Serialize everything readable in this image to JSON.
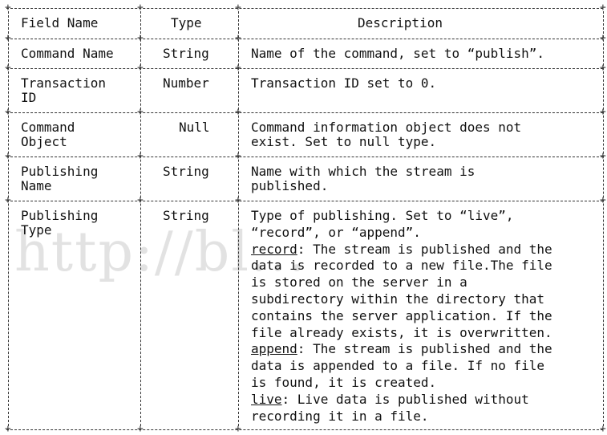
{
  "header": {
    "field_name": "Field Name",
    "type": "Type",
    "description": "Description"
  },
  "rows": [
    {
      "field": [
        "Command Name"
      ],
      "type": "String",
      "desc": [
        "Name of the command, set to “publish”."
      ]
    },
    {
      "field": [
        "Transaction",
        "ID"
      ],
      "type": "Number",
      "desc": [
        "Transaction ID set to 0."
      ]
    },
    {
      "field": [
        "Command",
        "Object"
      ],
      "type": "Null",
      "desc": [
        "Command information object does not",
        "exist. Set to null type."
      ]
    },
    {
      "field": [
        "Publishing",
        "Name"
      ],
      "type": "String",
      "desc": [
        "Name with which the stream is",
        "published."
      ]
    },
    {
      "field": [
        "Publishing",
        "Type"
      ],
      "type": "String",
      "desc": [
        "Type of publishing. Set to “live”,",
        "“record”, or “append”.",
        "record: The stream is published and the",
        "data is recorded to a new file.The file",
        "is stored on the server in a",
        "subdirectory within the directory that",
        "contains the server application. If the",
        "file already exists, it is overwritten.",
        "append: The stream is published and the",
        "data is appended to a file. If no file",
        "is found, it is created.",
        "live: Live data is published without",
        "recording it in a file."
      ],
      "underlined_terms": [
        "record",
        "append",
        "live"
      ]
    }
  ],
  "watermark": "http://bl..."
}
